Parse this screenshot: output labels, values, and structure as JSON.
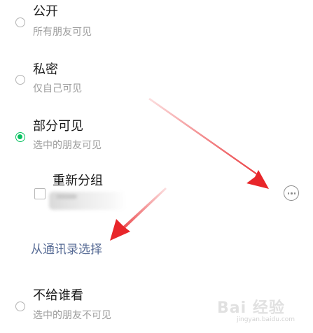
{
  "options": [
    {
      "title": "公开",
      "subtitle": "所有朋友可见",
      "selected": false
    },
    {
      "title": "私密",
      "subtitle": "仅自己可见",
      "selected": false
    },
    {
      "title": "部分可见",
      "subtitle": "选中的朋友可见",
      "selected": true
    },
    {
      "title": "不给谁看",
      "subtitle": "选中的朋友不可见",
      "selected": false
    }
  ],
  "group": {
    "title": "重新分组",
    "checked": false
  },
  "contacts_link": "从通讯录选择",
  "watermark": {
    "text": "Bai 经验",
    "url": "jingyan.baidu.com"
  },
  "colors": {
    "accent_green": "#07c160",
    "link_blue": "#576b95",
    "arrow_red": "#e8262a",
    "text_primary": "#191919",
    "text_secondary": "#9c9c9c"
  },
  "icons": {
    "more": "more-horizontal-circle-icon"
  }
}
